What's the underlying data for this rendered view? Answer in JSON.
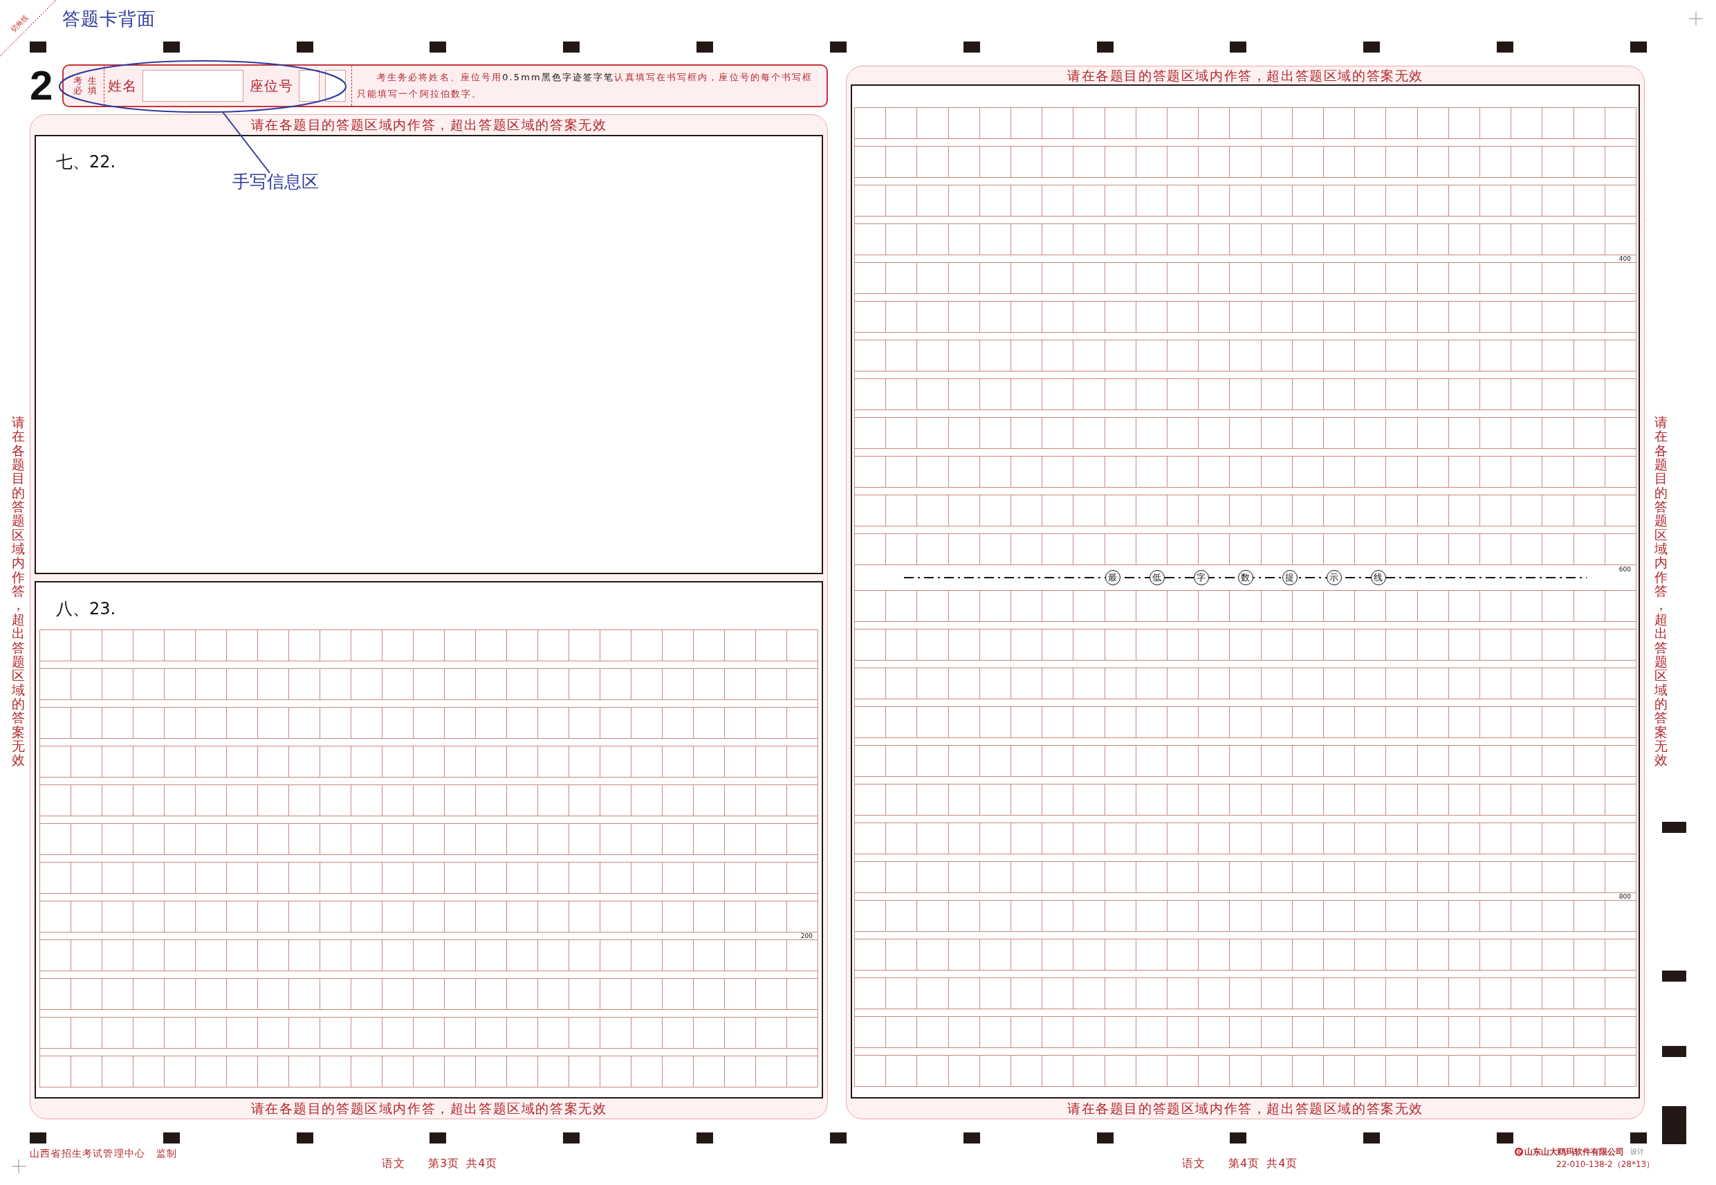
{
  "corner_mark": {
    "label": "切角线"
  },
  "title": "答题卡背面",
  "page_digit": "2",
  "info_box": {
    "required_label": "考生必填",
    "name_label": "姓名",
    "seat_label": "座位号",
    "instructions": [
      {
        "kind": "normal",
        "text": "考生务必将姓名、座位号用"
      },
      {
        "kind": "emphasis",
        "text": "0.5mm黑色字迹签字笔"
      },
      {
        "kind": "normal",
        "text": "认真填写在书写框内，座位号的每个书写框只能填写一个阿拉伯数字。"
      }
    ]
  },
  "annotation": {
    "label": "手写信息区"
  },
  "side_notices": [
    "请在各题目的答题区域内作答，超出答题区域的答案无效",
    "请在各题目的答题区域内作答，超出答题区域的答案无效"
  ],
  "panels": [
    {
      "header": "请在各题目的答题区域内作答，超出答题区域的答案无效",
      "footer": "请在各题目的答题区域内作答，超出答题区域的答案无效",
      "sections": [
        {
          "kind": "blank",
          "label": "七、22."
        },
        {
          "kind": "grid",
          "label": "八、23.",
          "count_marks": [
            "200"
          ]
        }
      ]
    },
    {
      "header": "请在各题目的答题区域内作答，超出答题区域的答案无效",
      "footer": "请在各题目的答题区域内作答，超出答题区域的答案无效",
      "sections": [
        {
          "kind": "grid",
          "count_marks": [
            "400",
            "600",
            "800"
          ],
          "minimum_line": [
            "最",
            "低",
            "字",
            "数",
            "提",
            "示",
            "线"
          ]
        }
      ]
    }
  ],
  "footer": {
    "credit": "山西省招生考试管理中心 监制",
    "pages": [
      {
        "subject": "语文",
        "page": "第3页 共4页"
      },
      {
        "subject": "语文",
        "page": "第4页 共4页"
      }
    ],
    "company": "山东山大鸥玛软件有限公司",
    "company_role": "设计",
    "code": "22-010-138-2（28*13）"
  }
}
